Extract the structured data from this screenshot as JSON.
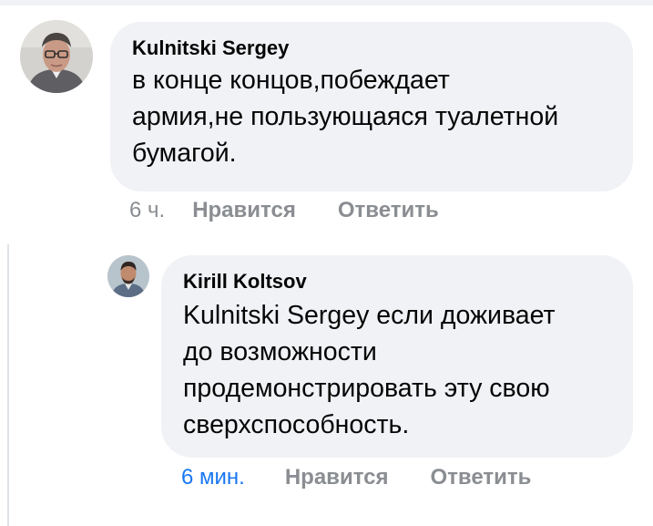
{
  "comments": [
    {
      "author": "Kulnitski Sergey",
      "lines": [
        "в конце концов,побеждает",
        "армия,не пользующаяся туалетной",
        "бумагой."
      ],
      "time": "6 ч.",
      "like_label": "Нравится",
      "reply_label": "Ответить"
    },
    {
      "author": "Kirill Koltsov",
      "lines": [
        "Kulnitski Sergey если доживает",
        "до возможности",
        "продемонстрировать эту свою",
        "сверхспособность."
      ],
      "time": "6 мин.",
      "like_label": "Нравится",
      "reply_label": "Ответить"
    }
  ],
  "colors": {
    "bubble": "#f0f2f5",
    "secondary_text": "#8a8d91",
    "link_blue": "#1877f2"
  },
  "icons": {
    "avatar_1": "user-photo-avatar",
    "avatar_2": "user-photo-avatar"
  }
}
